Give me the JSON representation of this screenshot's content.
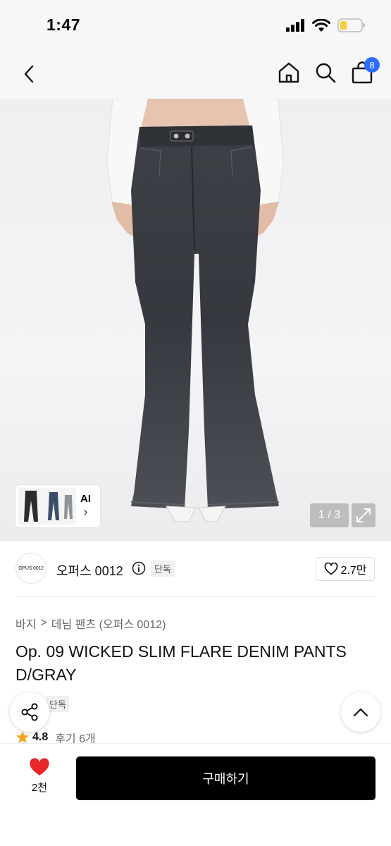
{
  "status_bar": {
    "time": "1:47"
  },
  "header": {
    "cart_count": "8"
  },
  "gallery": {
    "thumb_label": "AI",
    "thumb_arrow": "›",
    "counter": "1 / 3"
  },
  "brand": {
    "logo_text": "OPUS 0012",
    "name": "오퍼스 0012",
    "tag": "단독",
    "likes": "2.7만"
  },
  "breadcrumb": {
    "level1": "바지",
    "separator": ">",
    "level2": "데님 팬츠 (오퍼스 0012)"
  },
  "product": {
    "title": "Op. 09 WICKED SLIM FLARE DENIM PANTS D/GRAY",
    "exclusive_tag": "단독"
  },
  "rating": {
    "score": "4.8",
    "reviews": "후기 6개"
  },
  "bottom": {
    "wish_count": "2천",
    "buy_label": "구매하기"
  },
  "colors": {
    "accent": "#2f6bff",
    "wish_red": "#e8272b",
    "button_black": "#000000",
    "star": "#f5a623",
    "denim": "#3b3e44"
  }
}
